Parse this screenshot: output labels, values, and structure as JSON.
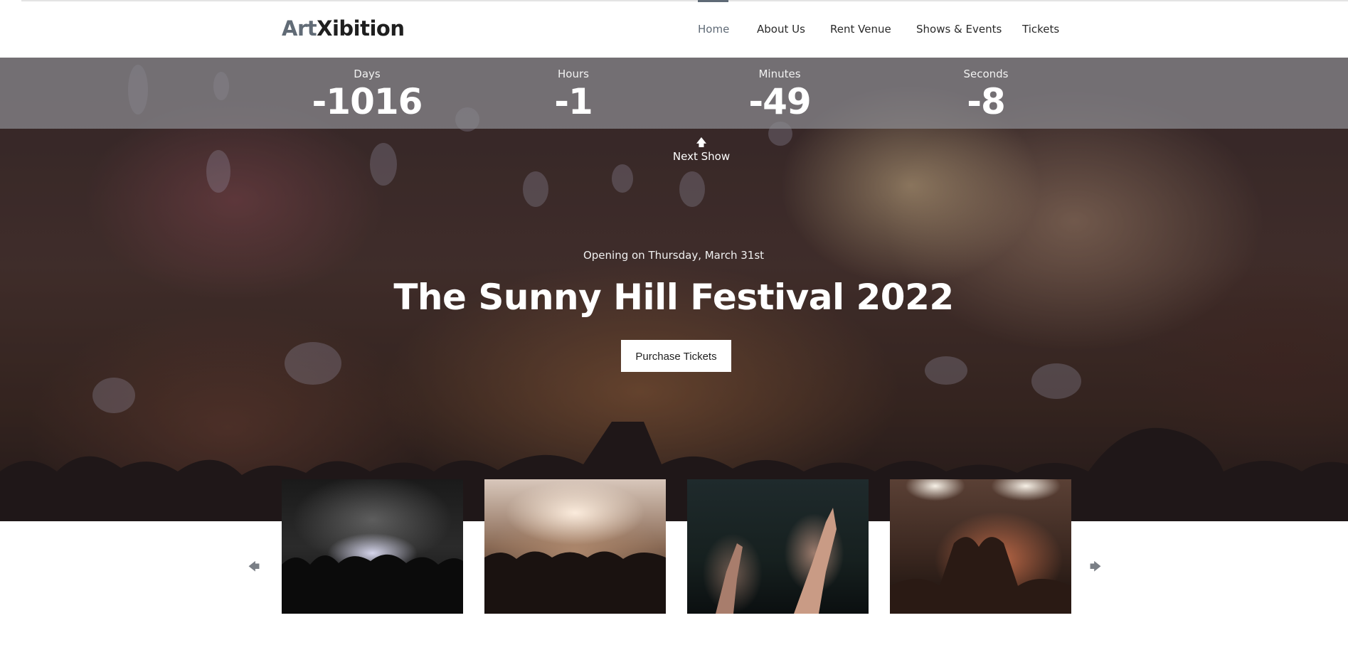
{
  "header": {
    "logo": {
      "art": "Art",
      "xib": "Xibition"
    },
    "nav": [
      "Home",
      "About Us",
      "Rent Venue",
      "Shows & Events",
      "Tickets"
    ],
    "active_nav": "Home"
  },
  "countdown": [
    {
      "label": "Days",
      "value": "-1016"
    },
    {
      "label": "Hours",
      "value": "-1"
    },
    {
      "label": "Minutes",
      "value": "-49"
    },
    {
      "label": "Seconds",
      "value": "-8"
    }
  ],
  "next_show": {
    "label": "Next Show",
    "icon": "arrow-up-icon"
  },
  "hero": {
    "subtitle": "Opening on Thursday, March 31st",
    "title": "The Sunny Hill Festival 2022",
    "cta": "Purchase Tickets"
  },
  "gallery": {
    "prev_icon": "arrow-left-icon",
    "next_icon": "arrow-right-icon",
    "images": [
      "concert-confetti",
      "stage-lights-crowd",
      "hands-raised-dark",
      "heart-hands-crowd"
    ]
  },
  "colors": {
    "accent": "#5f6a76",
    "logo_art": "#616b76",
    "text": "#2a2a2a"
  }
}
